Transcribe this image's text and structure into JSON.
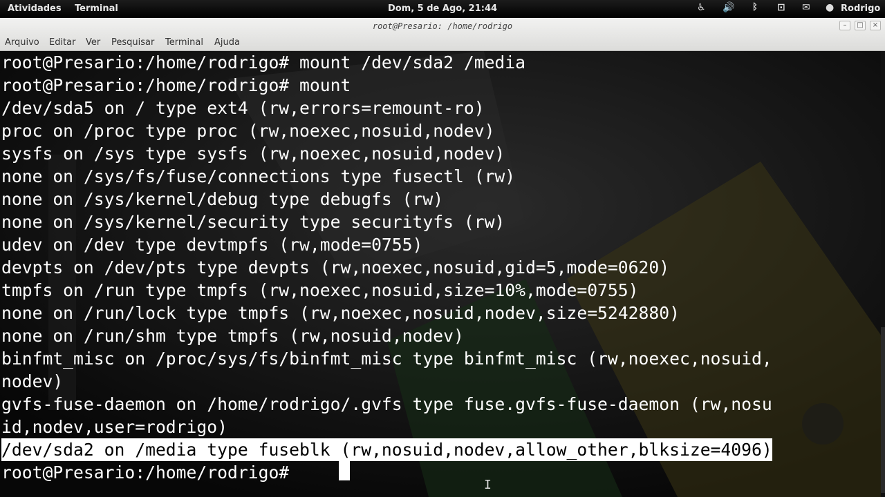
{
  "topbar": {
    "activities": "Atividades",
    "app_menu": "Terminal",
    "clock": "Dom,  5 de Ago, 21:44",
    "user": "Rodrigo",
    "tray_icons": [
      "accessibility-icon",
      "volume-icon",
      "bluetooth-icon",
      "network-icon",
      "chat-icon",
      "user-icon"
    ]
  },
  "window": {
    "title": "root@Presario: /home/rodrigo",
    "buttons": [
      "minimize",
      "maximize",
      "close"
    ]
  },
  "menubar": {
    "items": [
      "Arquivo",
      "Editar",
      "Ver",
      "Pesquisar",
      "Terminal",
      "Ajuda"
    ]
  },
  "terminal": {
    "lines": [
      "root@Presario:/home/rodrigo# mount /dev/sda2 /media",
      "root@Presario:/home/rodrigo# mount",
      "/dev/sda5 on / type ext4 (rw,errors=remount-ro)",
      "proc on /proc type proc (rw,noexec,nosuid,nodev)",
      "sysfs on /sys type sysfs (rw,noexec,nosuid,nodev)",
      "none on /sys/fs/fuse/connections type fusectl (rw)",
      "none on /sys/kernel/debug type debugfs (rw)",
      "none on /sys/kernel/security type securityfs (rw)",
      "udev on /dev type devtmpfs (rw,mode=0755)",
      "devpts on /dev/pts type devpts (rw,noexec,nosuid,gid=5,mode=0620)",
      "tmpfs on /run type tmpfs (rw,noexec,nosuid,size=10%,mode=0755)",
      "none on /run/lock type tmpfs (rw,noexec,nosuid,nodev,size=5242880)",
      "none on /run/shm type tmpfs (rw,nosuid,nodev)",
      "binfmt_misc on /proc/sys/fs/binfmt_misc type binfmt_misc (rw,noexec,nosuid,",
      "nodev)",
      "gvfs-fuse-daemon on /home/rodrigo/.gvfs type fuse.gvfs-fuse-daemon (rw,nosu",
      "id,nodev,user=rodrigo)",
      "/dev/sda2 on /media type fuseblk (rw,nosuid,nodev,allow_other,blksize=4096)",
      "root@Presario:/home/rodrigo# "
    ],
    "selected_line_index": 17,
    "prompt": "root@Presario:/home/rodrigo#"
  }
}
